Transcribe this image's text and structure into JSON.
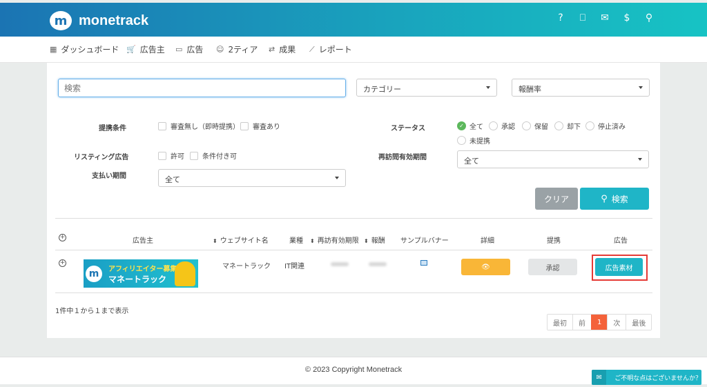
{
  "header": {
    "logo_mark": "m",
    "logo_text": "monetrack",
    "icons": [
      "help-icon",
      "book-icon",
      "mail-icon",
      "dollar-icon",
      "user-icon"
    ],
    "icon_glyphs": [
      "?",
      "⎕",
      "✉",
      "$",
      "⚲"
    ]
  },
  "nav": {
    "items": [
      {
        "label": "ダッシュボード",
        "icon": "grid-icon",
        "glyph": "▦"
      },
      {
        "label": "広告主",
        "icon": "cart-icon",
        "glyph": "🛒"
      },
      {
        "label": "広告",
        "icon": "ad-icon",
        "glyph": "▭"
      },
      {
        "label": "2ティア",
        "icon": "smile-icon",
        "glyph": "☺"
      },
      {
        "label": "成果",
        "icon": "exchange-icon",
        "glyph": "⇄"
      },
      {
        "label": "レポート",
        "icon": "chart-line-icon",
        "glyph": "⟋"
      }
    ]
  },
  "filters": {
    "search_placeholder": "検索",
    "category_value": "カテゴリー",
    "reward_value": "報酬率",
    "conditions_label": "提携条件",
    "cond_options": [
      "審査無し（即時提携）",
      "審査あり"
    ],
    "listing_label": "リスティング広告",
    "listing_options": [
      "許可",
      "条件付き可"
    ],
    "payment_label": "支払い期間",
    "payment_value": "全て",
    "status_label": "ステータス",
    "status_options": [
      "全て",
      "承認",
      "保留",
      "却下",
      "停止済み",
      "未提携"
    ],
    "revisit_label": "再訪問有効期間",
    "revisit_value": "全て",
    "clear_label": "クリア",
    "search_label": "検索"
  },
  "table": {
    "headers": [
      "広告主",
      "ウェブサイト名",
      "業種",
      "再訪有効期限",
      "報酬",
      "サンプルバナー",
      "詳細",
      "提携",
      "広告"
    ],
    "row": {
      "banner_line1": "アフィリエイター募集",
      "banner_line2": "マネートラック",
      "website": "マネートラック",
      "industry": "IT関連",
      "approve_label": "承認",
      "ad_label": "広告素材"
    },
    "info": "1件中１から１まで表示"
  },
  "pagination": {
    "items": [
      "最初",
      "前",
      "1",
      "次",
      "最後"
    ]
  },
  "footer": {
    "copyright": "© 2023 Copyright Monetrack",
    "chat_label": "ご不明な点はございませんか？"
  },
  "colors": {
    "accent": "#1fb5c7",
    "brand": "#1b74b3",
    "warning": "#f9b637",
    "active_page": "#f4623a",
    "highlight": "#e53935"
  }
}
